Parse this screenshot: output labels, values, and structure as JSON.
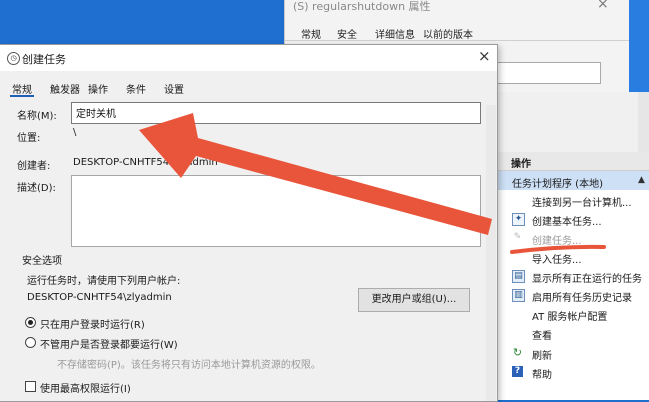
{
  "background_window": {
    "title": "(S) regularshutdown 属性",
    "close_glyph": "×",
    "tabs": [
      "常规",
      "安全",
      "详细信息",
      "以前的版本"
    ]
  },
  "dialog": {
    "title": "创建任务",
    "close_glyph": "×",
    "tabs": [
      "常规",
      "触发器",
      "操作",
      "条件",
      "设置"
    ],
    "name_label": "名称(M):",
    "name_value": "定时关机",
    "location_label": "位置:",
    "location_value": "\\",
    "author_label": "创建者:",
    "author_value": "DESKTOP-CNHTF54\\zlyadmin",
    "description_label": "描述(D):",
    "security_heading": "安全选项",
    "run_as_prompt": "运行任务时，请使用下列用户帐户:",
    "run_as_user": "DESKTOP-CNHTF54\\zlyadmin",
    "change_user_button": "更改用户或组(U)...",
    "radio_logged_on": "只在用户登录时运行(R)",
    "radio_whether_logged": "不管用户是否登录都要运行(W)",
    "no_store_password_note": "不存储密码(P)。该任务将只有访问本地计算机资源的权限。",
    "highest_privileges": "使用最高权限运行(I)"
  },
  "actions_panel": {
    "header": "操作",
    "group_label": "任务计划程序 (本地)",
    "group_arrow": "▲",
    "items": [
      {
        "label": "连接到另一台计算机...",
        "icon": "",
        "enabled": true
      },
      {
        "label": "创建基本任务...",
        "icon": "create-basic-task-icon",
        "enabled": true
      },
      {
        "label": "创建任务...",
        "icon": "create-task-icon",
        "enabled": false
      },
      {
        "label": "导入任务...",
        "icon": "",
        "enabled": true
      },
      {
        "label": "显示所有正在运行的任务",
        "icon": "running-tasks-icon",
        "enabled": true
      },
      {
        "label": "启用所有任务历史记录",
        "icon": "history-icon",
        "enabled": true
      },
      {
        "label": "AT 服务帐户配置",
        "icon": "",
        "enabled": true
      },
      {
        "label": "查看",
        "icon": "",
        "enabled": true
      },
      {
        "label": "刷新",
        "icon": "refresh-icon",
        "enabled": true
      },
      {
        "label": "帮助",
        "icon": "help-icon",
        "enabled": true
      }
    ]
  },
  "colors": {
    "annotation_red": "#e8553a",
    "selection_blue": "#cde0f5",
    "desktop_blue": "#1f6fd1"
  }
}
